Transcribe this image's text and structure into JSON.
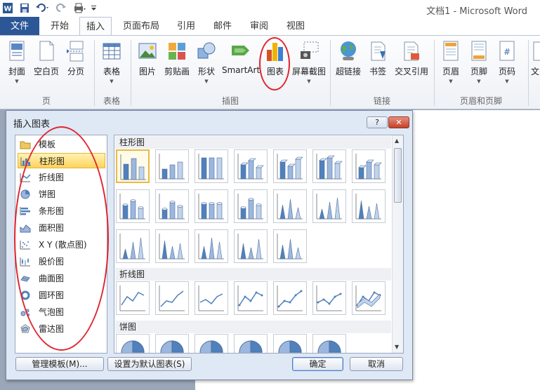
{
  "window": {
    "title": "文档1 - Microsoft Word"
  },
  "tabs": [
    {
      "label": "文件"
    },
    {
      "label": "开始"
    },
    {
      "label": "插入"
    },
    {
      "label": "页面布局"
    },
    {
      "label": "引用"
    },
    {
      "label": "邮件"
    },
    {
      "label": "审阅"
    },
    {
      "label": "视图"
    }
  ],
  "ribbon": {
    "buttons": [
      {
        "label": "封面",
        "icon": "cover-page-icon",
        "dropdown": true
      },
      {
        "label": "空白页",
        "icon": "blank-page-icon"
      },
      {
        "label": "分页",
        "icon": "page-break-icon"
      },
      {
        "label": "表格",
        "icon": "table-icon",
        "dropdown": true
      },
      {
        "label": "图片",
        "icon": "picture-icon"
      },
      {
        "label": "剪贴画",
        "icon": "clipart-icon"
      },
      {
        "label": "形状",
        "icon": "shapes-icon",
        "dropdown": true
      },
      {
        "label": "SmartArt",
        "icon": "smartart-icon"
      },
      {
        "label": "图表",
        "icon": "chart-icon"
      },
      {
        "label": "屏幕截图",
        "icon": "screenshot-icon",
        "dropdown": true
      },
      {
        "label": "超链接",
        "icon": "hyperlink-icon"
      },
      {
        "label": "书签",
        "icon": "bookmark-icon"
      },
      {
        "label": "交叉引用",
        "icon": "cross-reference-icon"
      },
      {
        "label": "页眉",
        "icon": "header-icon",
        "dropdown": true
      },
      {
        "label": "页脚",
        "icon": "footer-icon",
        "dropdown": true
      },
      {
        "label": "页码",
        "icon": "page-number-icon",
        "dropdown": true
      },
      {
        "label": "文",
        "icon": "textbox-icon"
      }
    ],
    "groups": [
      {
        "label": "页"
      },
      {
        "label": "表格"
      },
      {
        "label": "插图"
      },
      {
        "label": "链接"
      },
      {
        "label": "页眉和页脚"
      }
    ]
  },
  "dialog": {
    "title": "插入图表",
    "help_label": "?",
    "close_label": "✕",
    "chart_types": [
      {
        "label": "模板",
        "icon": "folder-icon"
      },
      {
        "label": "柱形图",
        "icon": "column-chart-icon"
      },
      {
        "label": "折线图",
        "icon": "line-chart-icon"
      },
      {
        "label": "饼图",
        "icon": "pie-chart-icon"
      },
      {
        "label": "条形图",
        "icon": "bar-chart-icon"
      },
      {
        "label": "面积图",
        "icon": "area-chart-icon"
      },
      {
        "label": "X Y (散点图)",
        "icon": "scatter-chart-icon"
      },
      {
        "label": "股价图",
        "icon": "stock-chart-icon"
      },
      {
        "label": "曲面图",
        "icon": "surface-chart-icon"
      },
      {
        "label": "圆环图",
        "icon": "doughnut-chart-icon"
      },
      {
        "label": "气泡图",
        "icon": "bubble-chart-icon"
      },
      {
        "label": "雷达图",
        "icon": "radar-chart-icon"
      }
    ],
    "selected_type": "柱形图",
    "categories": [
      {
        "label": "柱形图"
      },
      {
        "label": "折线图"
      },
      {
        "label": "饼图"
      }
    ],
    "manage_templates_label": "管理模板(M)...",
    "set_default_label": "设置为默认图表(S)",
    "ok_label": "确定",
    "cancel_label": "取消"
  },
  "colors": {
    "accent": "#2b5797",
    "annotation": "#e0262f",
    "selection": "#ffd35e"
  }
}
